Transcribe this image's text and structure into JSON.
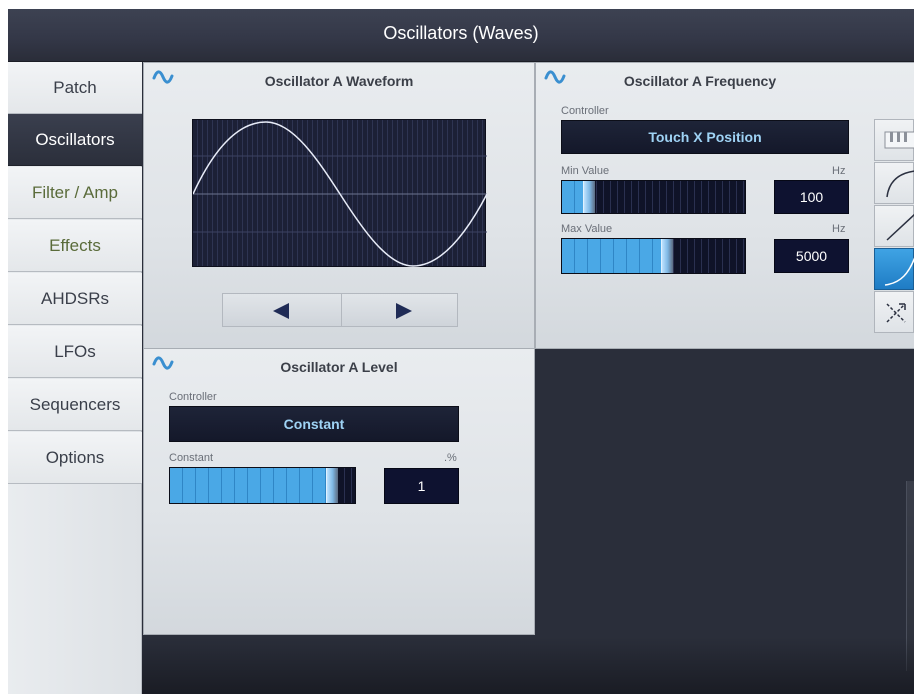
{
  "title": "Oscillators (Waves)",
  "sidebar": {
    "items": [
      {
        "label": "Patch",
        "active": false
      },
      {
        "label": "Oscillators",
        "active": true
      },
      {
        "label": "Filter / Amp",
        "active": false
      },
      {
        "label": "Effects",
        "active": false
      },
      {
        "label": "AHDSRs",
        "active": false
      },
      {
        "label": "LFOs",
        "active": false
      },
      {
        "label": "Sequencers",
        "active": false
      },
      {
        "label": "Options",
        "active": false
      }
    ]
  },
  "waveform_panel": {
    "title": "Oscillator A Waveform",
    "icon": "sine-wave-icon",
    "prev_icon": "triangle-left-icon",
    "next_icon": "triangle-right-icon"
  },
  "frequency_panel": {
    "title": "Oscillator A Frequency",
    "icon": "sine-wave-icon",
    "controller_label": "Controller",
    "controller_value": "Touch X Position",
    "min_label": "Min Value",
    "min_unit": "Hz",
    "min_value": "100",
    "min_fraction": 0.12,
    "max_label": "Max Value",
    "max_unit": "Hz",
    "max_value": "5000",
    "max_fraction": 0.58,
    "curve_options": [
      "piano-keys-icon",
      "curve-convex-icon",
      "curve-linear-icon",
      "curve-exponential-icon",
      "curve-random-icon"
    ],
    "selected_curve": "curve-exponential-icon"
  },
  "level_panel": {
    "title": "Oscillator A Level",
    "icon": "sine-wave-icon",
    "controller_label": "Controller",
    "controller_value": "Constant",
    "constant_label": "Constant",
    "constant_unit": ".%",
    "constant_value": "1",
    "constant_fraction": 0.9
  },
  "colors": {
    "accent": "#3fa3e4",
    "dark": "#2a2e3a",
    "readout_text": "#9fd3f5"
  }
}
